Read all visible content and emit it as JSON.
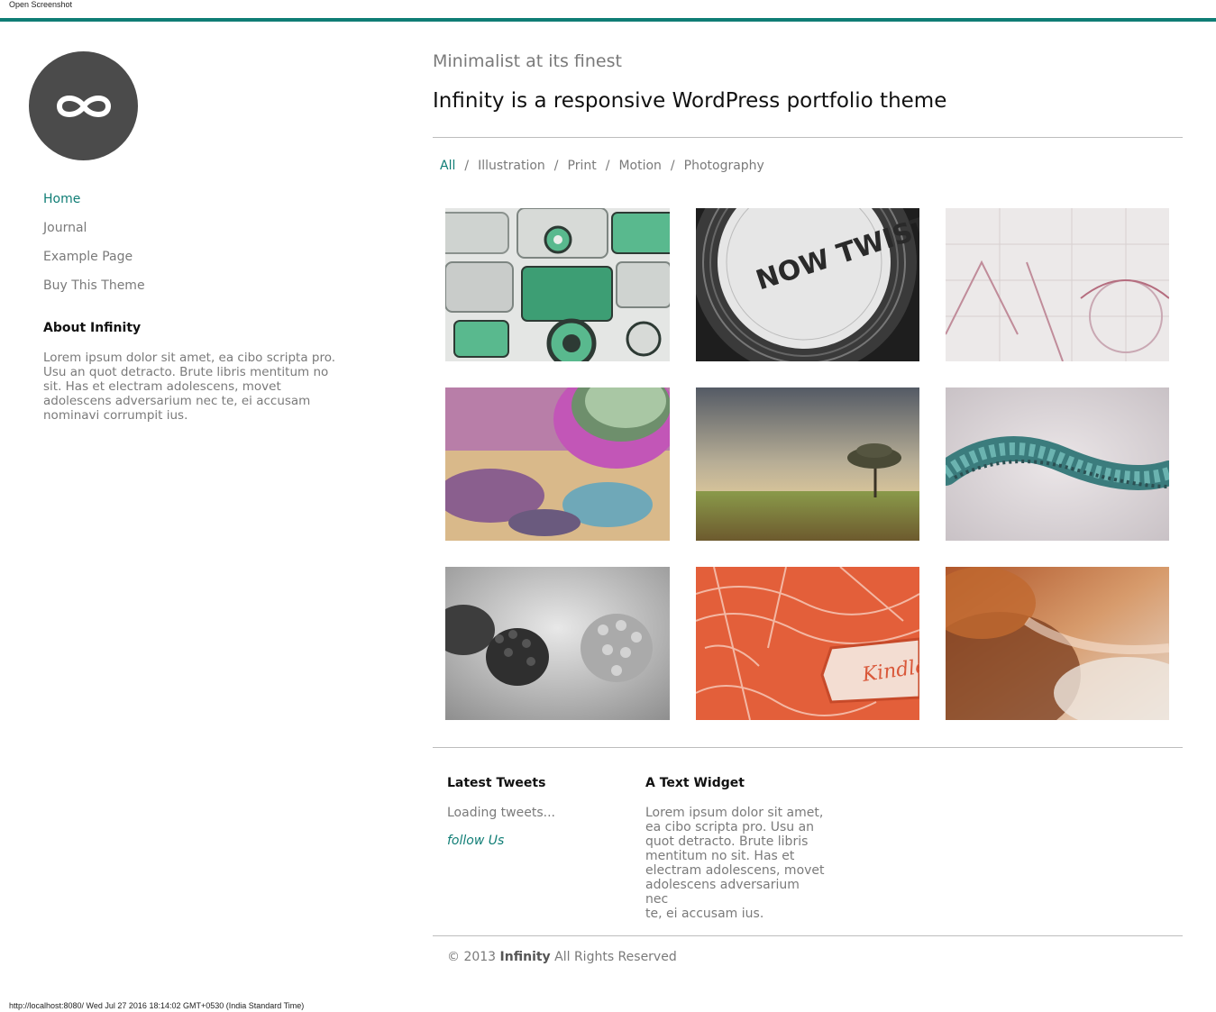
{
  "window": {
    "caption": "Open Screenshot",
    "status_line": "http://localhost:8080/ Wed Jul 27 2016 18:14:02 GMT+0530 (India Standard Time)"
  },
  "colors": {
    "accent": "#0f7d75",
    "logo_bg": "#4b4b4b",
    "muted_text": "#7a7a7a",
    "rule": "#bdbdbd"
  },
  "logo": {
    "icon": "infinity-icon"
  },
  "nav": {
    "items": [
      {
        "label": "Home",
        "active": true
      },
      {
        "label": "Journal",
        "active": false
      },
      {
        "label": "Example Page",
        "active": false
      },
      {
        "label": "Buy This Theme",
        "active": false
      }
    ]
  },
  "about": {
    "title": "About Infinity",
    "text": "Lorem ipsum dolor sit amet, ea cibo scripta pro. Usu an quot detracto. Brute libris mentitum no sit. Has et electram adolescens, movet adolescens adversarium nec te, ei accusam nominavi corrumpit ius."
  },
  "header": {
    "tagline": "Minimalist at its finest",
    "headline": "Infinity is a responsive WordPress portfolio theme"
  },
  "filters": {
    "items": [
      "All",
      "Illustration",
      "Print",
      "Motion",
      "Photography"
    ],
    "active": "All",
    "separator": "/"
  },
  "portfolio": {
    "items": [
      {
        "name": "portfolio-radio-illustration",
        "thumb_text": ""
      },
      {
        "name": "portfolio-now-twist-print",
        "thumb_text": "NOW TWIST DOTCOM"
      },
      {
        "name": "portfolio-sketch-lines",
        "thumb_text": ""
      },
      {
        "name": "portfolio-blurry-cylinders",
        "thumb_text": ""
      },
      {
        "name": "portfolio-landscape-tree",
        "thumb_text": ""
      },
      {
        "name": "portfolio-twisted-rope",
        "thumb_text": ""
      },
      {
        "name": "portfolio-lego-cubes",
        "thumb_text": ""
      },
      {
        "name": "portfolio-kindle-print",
        "thumb_text": "Kindle"
      },
      {
        "name": "portfolio-orange-smoke",
        "thumb_text": ""
      }
    ]
  },
  "widgets": {
    "tweets": {
      "title": "Latest Tweets",
      "loading": "Loading tweets...",
      "follow": "follow Us"
    },
    "text_widget": {
      "title": "A Text Widget",
      "lines": [
        "Lorem ipsum dolor sit amet,",
        "ea cibo scripta pro. Usu an",
        "quot detracto. Brute libris",
        "mentitum no sit. Has et",
        "electram adolescens, movet",
        "adolescens adversarium nec",
        "te, ei accusam ius."
      ]
    }
  },
  "footer": {
    "copyright": "© 2013",
    "brand": "Infinity",
    "rights": "All Rights Reserved"
  }
}
